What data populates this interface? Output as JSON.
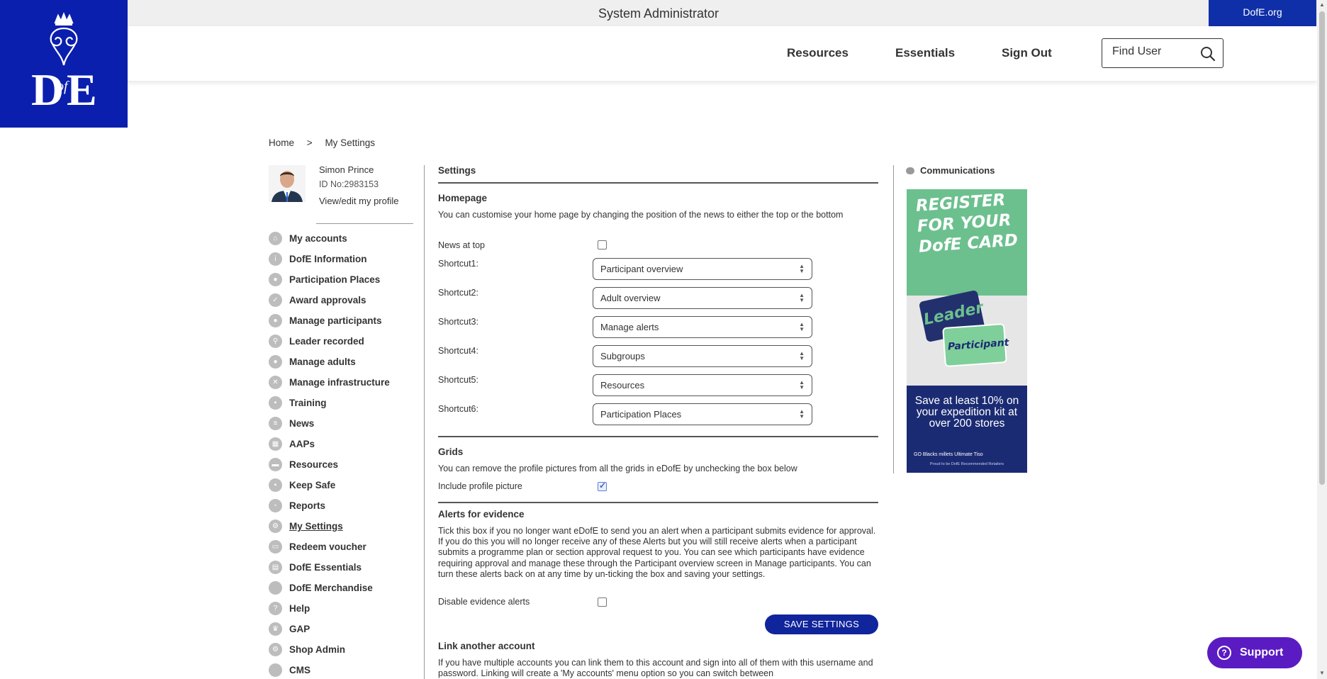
{
  "topbar": {
    "title": "System Administrator",
    "dofe_link": "DofE.org"
  },
  "header": {
    "nav": [
      "Resources",
      "Essentials",
      "Sign Out"
    ],
    "search_placeholder": "Find User"
  },
  "breadcrumb": {
    "home": "Home",
    "sep": ">",
    "current": "My Settings"
  },
  "profile": {
    "name": "Simon Prince",
    "id": "ID No:2983153",
    "link": "View/edit my profile"
  },
  "menu": [
    {
      "label": "My accounts",
      "icon": "home-icon"
    },
    {
      "label": "DofE Information",
      "icon": "info-icon"
    },
    {
      "label": "Participation Places",
      "icon": "person-icon"
    },
    {
      "label": "Award approvals",
      "icon": "badge-icon"
    },
    {
      "label": "Manage participants",
      "icon": "people-icon"
    },
    {
      "label": "Leader recorded",
      "icon": "walker-icon"
    },
    {
      "label": "Manage adults",
      "icon": "adults-icon"
    },
    {
      "label": "Manage infrastructure",
      "icon": "cross-icon"
    },
    {
      "label": "Training",
      "icon": "training-icon"
    },
    {
      "label": "News",
      "icon": "news-icon"
    },
    {
      "label": "AAPs",
      "icon": "grid-icon"
    },
    {
      "label": "Resources",
      "icon": "folder-icon"
    },
    {
      "label": "Keep Safe",
      "icon": "lock-icon"
    },
    {
      "label": "Reports",
      "icon": "report-icon"
    },
    {
      "label": "My Settings",
      "icon": "gear-icon",
      "active": true
    },
    {
      "label": "Redeem voucher",
      "icon": "voucher-icon"
    },
    {
      "label": "DofE Essentials",
      "icon": "essentials-icon"
    },
    {
      "label": "DofE Merchandise",
      "icon": "merch-icon"
    },
    {
      "label": "Help",
      "icon": "help-icon"
    },
    {
      "label": "GAP",
      "icon": "gap-icon"
    },
    {
      "label": "Shop Admin",
      "icon": "shop-icon"
    },
    {
      "label": "CMS",
      "icon": "cms-icon"
    }
  ],
  "settings": {
    "title": "Settings",
    "homepage": {
      "heading": "Homepage",
      "desc": "You can customise your home page by changing the position of the news to either the top or the bottom",
      "news_label": "News at top",
      "news_checked": false,
      "shortcuts": [
        {
          "label": "Shortcut1:",
          "value": "Participant overview"
        },
        {
          "label": "Shortcut2:",
          "value": "Adult overview"
        },
        {
          "label": "Shortcut3:",
          "value": "Manage alerts"
        },
        {
          "label": "Shortcut4:",
          "value": "Subgroups"
        },
        {
          "label": "Shortcut5:",
          "value": "Resources"
        },
        {
          "label": "Shortcut6:",
          "value": "Participation Places"
        }
      ]
    },
    "grids": {
      "heading": "Grids",
      "desc": "You can remove the profile pictures from all the grids in eDofE by unchecking the box below",
      "label": "Include profile picture",
      "checked": true
    },
    "alerts": {
      "heading": "Alerts for evidence",
      "desc": "Tick this box if you no longer want eDofE to send you an alert when a participant submits evidence for approval. If you do this you will no longer receive any of these Alerts but you will still receive alerts when a participant submits a programme plan or section approval request to you. You can see which participants have evidence requiring approval and manage these through the Participant overview screen in Manage participants. You can turn these alerts back on at any time by un-ticking the box and saving your settings.",
      "label": "Disable evidence alerts",
      "checked": false
    },
    "save_label": "SAVE SETTINGS",
    "link": {
      "heading": "Link another account",
      "desc": "If you have multiple accounts you can link them to this account and sign into all of them with this username and password. Linking will create a 'My accounts' menu option so you can switch between"
    }
  },
  "communications": {
    "title": "Communications",
    "ad": {
      "headline": "REGISTER FOR YOUR DofE CARD",
      "card1": "Leader",
      "card2": "Participant",
      "offer": "Save at least 10% on your expedition kit at over 200 stores",
      "brands": "GO  Blacks  millets  Ultimate  Tiso",
      "proud": "Proud to be DofE Recommended Retailers"
    }
  },
  "support_label": "Support",
  "colors": {
    "brand_blue": "#0a1fae",
    "support_purple": "#5b1bc2",
    "save_blue": "#10249b"
  }
}
